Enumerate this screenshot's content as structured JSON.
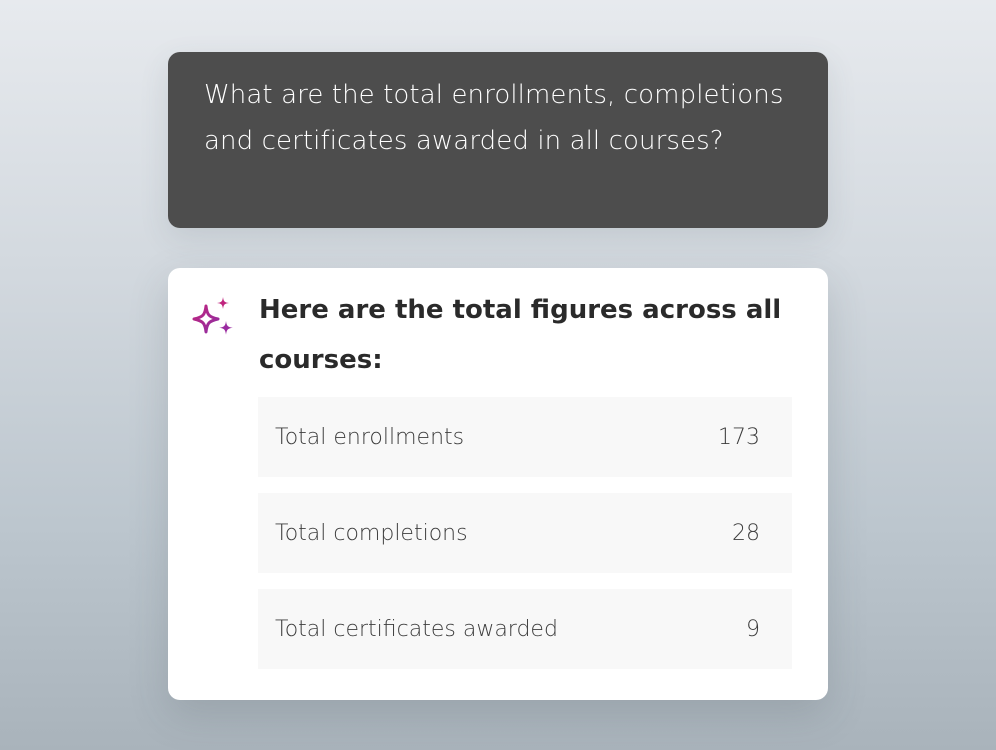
{
  "user_message": {
    "text": "What are the total enrollments, completions and certificates awarded in all courses?"
  },
  "assistant": {
    "icon": "sparkle-icon",
    "accent_colors": [
      "#c0247e",
      "#8e2ea3"
    ],
    "heading": "Here are the total figures across all courses:",
    "stats": [
      {
        "label": "Total enrollments",
        "value": "173"
      },
      {
        "label": "Total completions",
        "value": "28"
      },
      {
        "label": "Total certificates awarded",
        "value": "9"
      }
    ]
  }
}
